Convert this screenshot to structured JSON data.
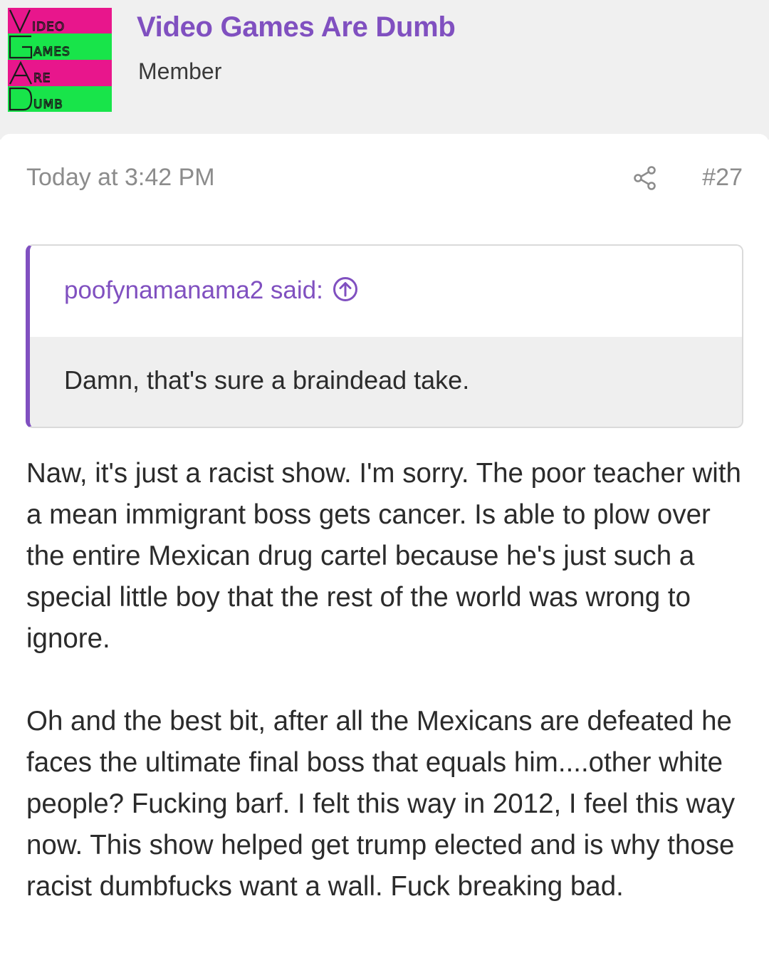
{
  "author": {
    "avatar_text": [
      "Video",
      "Games",
      "Are",
      "Dumb"
    ],
    "name": "Video Games Are Dumb",
    "title": "Member"
  },
  "post": {
    "date": "Today at 3:42 PM",
    "number": "#27",
    "quote": {
      "author_line": "poofynamanama2 said:",
      "text": "Damn, that's sure a braindead take."
    },
    "paragraphs": [
      "Naw, it's just a racist show. I'm sorry. The poor teacher with a mean immigrant boss gets cancer. Is able to plow over the entire Mexican drug cartel because he's just such a special little boy that the rest of the world was wrong to ignore.",
      "Oh and the best bit, after all the Mexicans are defeated he faces the ultimate final boss that equals him....other white people? Fucking barf. I felt this way in 2012, I feel this way now. This show helped get trump elected and is why those racist dumbfucks want a wall. Fuck breaking bad."
    ]
  },
  "colors": {
    "accent": "#8050c0",
    "avatar_pink": "#e8168c",
    "avatar_green": "#18e44a",
    "muted_text": "#8c8c8c",
    "header_bg": "#f0f0f0",
    "quote_bg": "#efefef"
  },
  "icons": {
    "share": "share-icon",
    "quote_jump": "arrow-up-circle-icon"
  }
}
